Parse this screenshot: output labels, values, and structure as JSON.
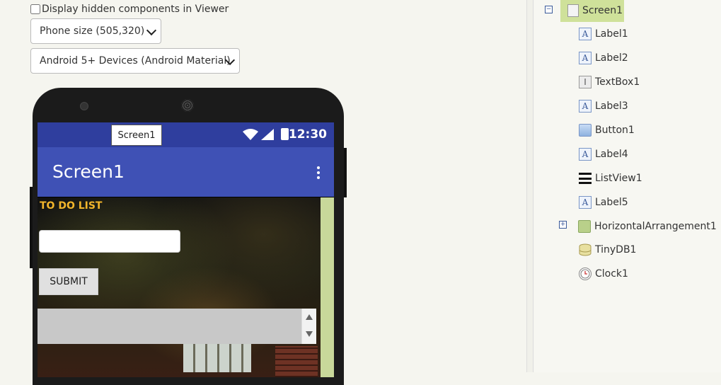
{
  "viewer": {
    "hidden_components_label": "Display hidden components in Viewer",
    "size_select": "Phone size (505,320)",
    "theme_select": "Android 5+ Devices (Android Material)"
  },
  "phone": {
    "tooltip": "Screen1",
    "status_time": "12:30",
    "app_title": "Screen1",
    "label_todo": "TO DO LIST",
    "textbox_value": "",
    "submit_label": "SUBMIT"
  },
  "components": {
    "root": "Screen1",
    "items": [
      {
        "name": "Label1",
        "icon": "label-icon"
      },
      {
        "name": "Label2",
        "icon": "label-icon"
      },
      {
        "name": "TextBox1",
        "icon": "textbox-icon"
      },
      {
        "name": "Label3",
        "icon": "label-icon"
      },
      {
        "name": "Button1",
        "icon": "button-icon"
      },
      {
        "name": "Label4",
        "icon": "label-icon"
      },
      {
        "name": "ListView1",
        "icon": "listview-icon"
      },
      {
        "name": "Label5",
        "icon": "label-icon"
      },
      {
        "name": "HorizontalArrangement1",
        "icon": "horizontal-arrangement-icon"
      },
      {
        "name": "TinyDB1",
        "icon": "database-icon"
      },
      {
        "name": "Clock1",
        "icon": "clock-icon"
      }
    ]
  },
  "colors": {
    "statusbar": "#2f3e9e",
    "appbar": "#3f51b5",
    "todo_label": "#f2b52b",
    "selected_node": "#cfe19a"
  }
}
